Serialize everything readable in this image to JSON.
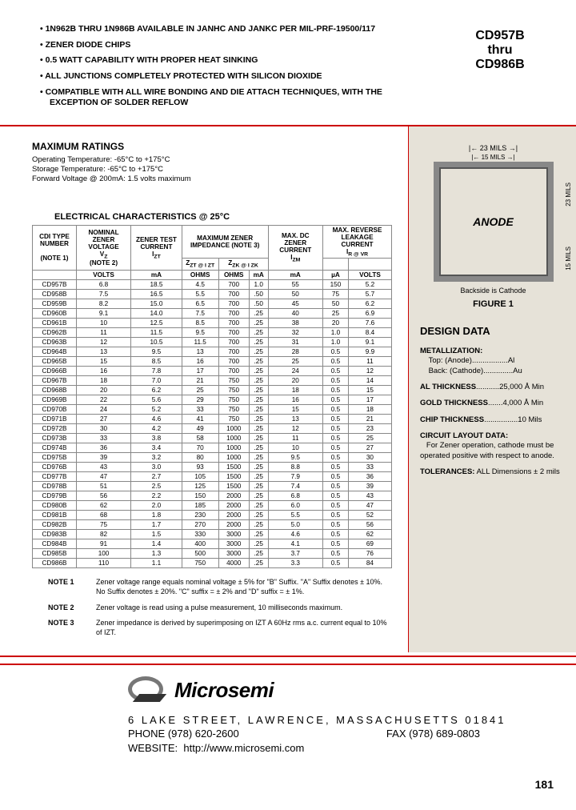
{
  "part_range": {
    "from": "CD957B",
    "mid": "thru",
    "to": "CD986B"
  },
  "bullets": [
    "1N962B THRU 1N986B AVAILABLE IN JANHC AND JANKC PER MIL-PRF-19500/117",
    "ZENER DIODE CHIPS",
    "0.5 WATT CAPABILITY WITH PROPER HEAT SINKING",
    "ALL JUNCTIONS COMPLETELY PROTECTED WITH SILICON DIOXIDE",
    "COMPATIBLE WITH ALL WIRE BONDING AND DIE ATTACH TECHNIQUES, WITH THE EXCEPTION OF SOLDER REFLOW"
  ],
  "max_ratings": {
    "title": "MAXIMUM RATINGS",
    "lines": [
      "Operating Temperature: -65°C to +175°C",
      "Storage Temperature: -65°C to +175°C",
      "Forward Voltage @ 200mA: 1.5 volts maximum"
    ]
  },
  "elec_title": "ELECTRICAL CHARACTERISTICS @ 25°C",
  "headers": {
    "c1": "CDI TYPE NUMBER",
    "c1n": "(NOTE 1)",
    "c2": "NOMINAL ZENER VOLTAGE",
    "c2s": "V",
    "c2sub": "Z",
    "c2n": "(NOTE 2)",
    "c3": "ZENER TEST CURRENT",
    "c3s": "I",
    "c3sub": "ZT",
    "c4": "MAXIMUM ZENER IMPEDANCE (NOTE 3)",
    "c4a": "Z",
    "c4a2": "ZT @ I ZT",
    "c4b": "Z",
    "c4b2": "ZK @ I ZK",
    "c5": "MAX. DC ZENER CURRENT",
    "c5s": "I",
    "c5sub": "ZM",
    "c6": "MAX. REVERSE LEAKAGE CURRENT",
    "c6s": "I",
    "c6sub": "R @ VR",
    "u_volts": "VOLTS",
    "u_ma": "mA",
    "u_ohms": "OHMS",
    "u_ua": "µA"
  },
  "rows": [
    [
      "CD957B",
      "6.8",
      "18.5",
      "4.5",
      "700",
      "1.0",
      "55",
      "150",
      "5.2"
    ],
    [
      "CD958B",
      "7.5",
      "16.5",
      "5.5",
      "700",
      ".50",
      "50",
      "75",
      "5.7"
    ],
    [
      "CD959B",
      "8.2",
      "15.0",
      "6.5",
      "700",
      ".50",
      "45",
      "50",
      "6.2"
    ],
    [
      "CD960B",
      "9.1",
      "14.0",
      "7.5",
      "700",
      ".25",
      "40",
      "25",
      "6.9"
    ],
    [
      "CD961B",
      "10",
      "12.5",
      "8.5",
      "700",
      ".25",
      "38",
      "20",
      "7.6"
    ],
    [
      "CD962B",
      "11",
      "11.5",
      "9.5",
      "700",
      ".25",
      "32",
      "1.0",
      "8.4"
    ],
    [
      "CD963B",
      "12",
      "10.5",
      "11.5",
      "700",
      ".25",
      "31",
      "1.0",
      "9.1"
    ],
    [
      "CD964B",
      "13",
      "9.5",
      "13",
      "700",
      ".25",
      "28",
      "0.5",
      "9.9"
    ],
    [
      "CD965B",
      "15",
      "8.5",
      "16",
      "700",
      ".25",
      "25",
      "0.5",
      "11"
    ],
    [
      "CD966B",
      "16",
      "7.8",
      "17",
      "700",
      ".25",
      "24",
      "0.5",
      "12"
    ],
    [
      "CD967B",
      "18",
      "7.0",
      "21",
      "750",
      ".25",
      "20",
      "0.5",
      "14"
    ],
    [
      "CD968B",
      "20",
      "6.2",
      "25",
      "750",
      ".25",
      "18",
      "0.5",
      "15"
    ],
    [
      "CD969B",
      "22",
      "5.6",
      "29",
      "750",
      ".25",
      "16",
      "0.5",
      "17"
    ],
    [
      "CD970B",
      "24",
      "5.2",
      "33",
      "750",
      ".25",
      "15",
      "0.5",
      "18"
    ],
    [
      "CD971B",
      "27",
      "4.6",
      "41",
      "750",
      ".25",
      "13",
      "0.5",
      "21"
    ],
    [
      "CD972B",
      "30",
      "4.2",
      "49",
      "1000",
      ".25",
      "12",
      "0.5",
      "23"
    ],
    [
      "CD973B",
      "33",
      "3.8",
      "58",
      "1000",
      ".25",
      "11",
      "0.5",
      "25"
    ],
    [
      "CD974B",
      "36",
      "3.4",
      "70",
      "1000",
      ".25",
      "10",
      "0.5",
      "27"
    ],
    [
      "CD975B",
      "39",
      "3.2",
      "80",
      "1000",
      ".25",
      "9.5",
      "0.5",
      "30"
    ],
    [
      "CD976B",
      "43",
      "3.0",
      "93",
      "1500",
      ".25",
      "8.8",
      "0.5",
      "33"
    ],
    [
      "CD977B",
      "47",
      "2.7",
      "105",
      "1500",
      ".25",
      "7.9",
      "0.5",
      "36"
    ],
    [
      "CD978B",
      "51",
      "2.5",
      "125",
      "1500",
      ".25",
      "7.4",
      "0.5",
      "39"
    ],
    [
      "CD979B",
      "56",
      "2.2",
      "150",
      "2000",
      ".25",
      "6.8",
      "0.5",
      "43"
    ],
    [
      "CD980B",
      "62",
      "2.0",
      "185",
      "2000",
      ".25",
      "6.0",
      "0.5",
      "47"
    ],
    [
      "CD981B",
      "68",
      "1.8",
      "230",
      "2000",
      ".25",
      "5.5",
      "0.5",
      "52"
    ],
    [
      "CD982B",
      "75",
      "1.7",
      "270",
      "2000",
      ".25",
      "5.0",
      "0.5",
      "56"
    ],
    [
      "CD983B",
      "82",
      "1.5",
      "330",
      "3000",
      ".25",
      "4.6",
      "0.5",
      "62"
    ],
    [
      "CD984B",
      "91",
      "1.4",
      "400",
      "3000",
      ".25",
      "4.1",
      "0.5",
      "69"
    ],
    [
      "CD985B",
      "100",
      "1.3",
      "500",
      "3000",
      ".25",
      "3.7",
      "0.5",
      "76"
    ],
    [
      "CD986B",
      "110",
      "1.1",
      "750",
      "4000",
      ".25",
      "3.3",
      "0.5",
      "84"
    ]
  ],
  "notes": [
    {
      "label": "NOTE 1",
      "text": "Zener voltage range equals nominal voltage ± 5% for \"B\" Suffix. \"A\" Suffix denotes ± 10%. No Suffix denotes ± 20%. \"C\" suffix = ± 2% and \"D\" suffix = ± 1%."
    },
    {
      "label": "NOTE 2",
      "text": "Zener voltage is read using a pulse measurement, 10 milliseconds maximum."
    },
    {
      "label": "NOTE 3",
      "text": "Zener impedance is derived by superimposing on IZT A 60Hz rms a.c. current equal to 10% of IZT."
    }
  ],
  "figure": {
    "outer_dim": "23 MILS",
    "inner_dim": "15 MILS",
    "anode": "ANODE",
    "caption": "Backside is Cathode",
    "label": "FIGURE 1"
  },
  "design": {
    "title": "DESIGN DATA",
    "metallization": {
      "label": "METALLIZATION:",
      "top": "Top: (Anode).................Al",
      "back": "Back: (Cathode)..............Au"
    },
    "al": {
      "label": "AL THICKNESS",
      "dots": "...........",
      "val": "25,000 Å Min"
    },
    "gold": {
      "label": "GOLD THICKNESS",
      "dots": ".......",
      "val": "4,000 Å Min"
    },
    "chip": {
      "label": "CHIP THICKNESS",
      "dots": "................",
      "val": "10 Mils"
    },
    "layout": {
      "label": "CIRCUIT LAYOUT DATA:",
      "text": "For Zener operation, cathode must be operated positive with respect to anode."
    },
    "tol": {
      "label": "TOLERANCES:",
      "text": "ALL Dimensions ± 2 mils"
    }
  },
  "footer": {
    "brand": "Microsemi",
    "addr1": "6 LAKE STREET, LAWRENCE, MASSACHUSETTS 01841",
    "phone": "PHONE (978) 620-2600",
    "fax": "FAX (978) 689-0803",
    "website_label": "WEBSITE:",
    "website": "http://www.microsemi.com",
    "page": "181"
  }
}
